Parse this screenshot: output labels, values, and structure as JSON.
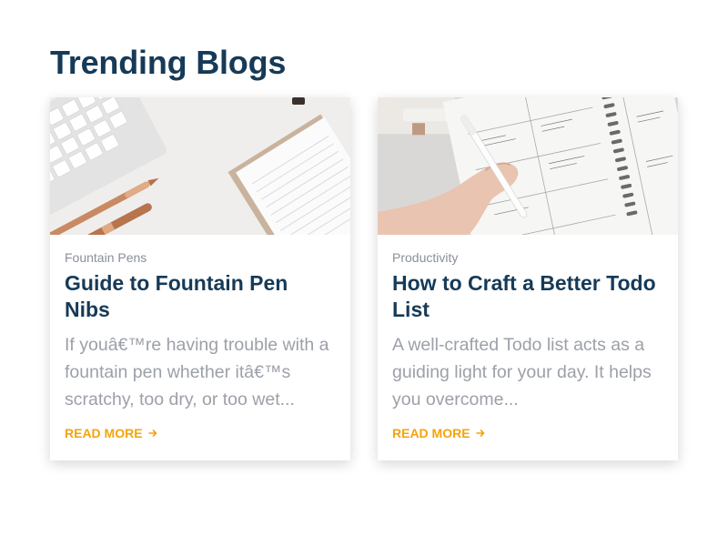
{
  "section": {
    "title": "Trending Blogs"
  },
  "blogs": [
    {
      "category": "Fountain Pens",
      "title": "Guide to Fountain Pen Nibs",
      "excerpt": "If youâ€™re having trouble with a fountain pen whether itâ€™s scratchy, too dry, or too wet...",
      "read_more": "READ MORE",
      "image": "keyboard-and-pens-photo"
    },
    {
      "category": "Productivity",
      "title": "How to Craft a Better Todo List",
      "excerpt": "A well-crafted Todo list acts as a guiding light for your day. It helps you overcome...",
      "read_more": "READ MORE",
      "image": "planner-and-pen-photo"
    }
  ],
  "colors": {
    "heading": "#163a57",
    "accent": "#f5a30a",
    "muted": "#9ca0a8"
  },
  "icons": {
    "read_more": "arrow-right-icon"
  }
}
